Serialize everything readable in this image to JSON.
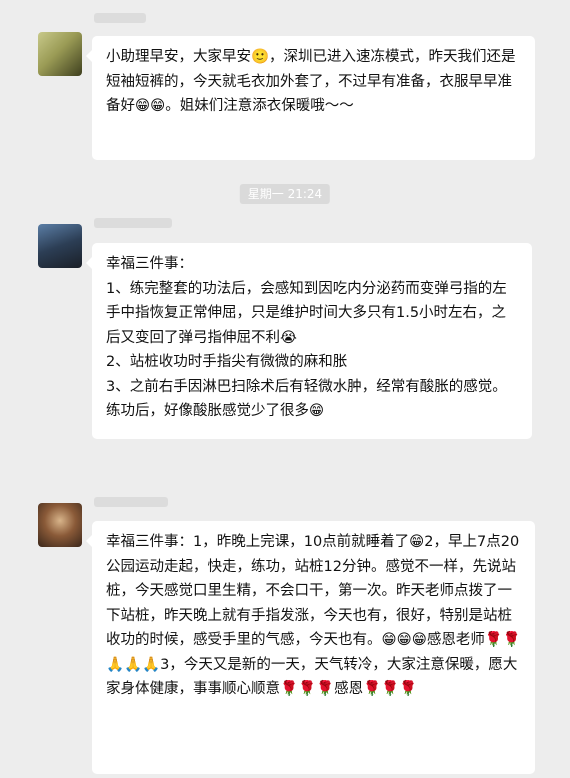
{
  "chat": {
    "timestamp": "星期一 21:24",
    "messages": [
      {
        "text": "小助理早安，大家早安🙂，深圳已进入速冻模式，昨天我们还是短袖短裤的，今天就毛衣加外套了，不过早有准备，衣服早早准备好😁😁。姐妹们注意添衣保暖哦～～"
      },
      {
        "text": "幸福三件事：\n1、练完整套的功法后，会感知到因吃内分泌药而变弹弓指的左手中指恢复正常伸屈，只是维护时间大多只有1.5小时左右，之后又变回了弹弓指伸屈不利😭\n2、站桩收功时手指尖有微微的麻和胀\n3、之前右手因淋巴扫除术后有轻微水肿，经常有酸胀的感觉。练功后，好像酸胀感觉少了很多😁"
      },
      {
        "text": "幸福三件事：1，昨晚上完课，10点前就睡着了😁2，早上7点20公园运动走起，快走，练功，站桩12分钟。感觉不一样，先说站桩，今天感觉口里生精，不会口干，第一次。昨天老师点拨了一下站桩，昨天晚上就有手指发涨，今天也有，很好，特别是站桩收功的时候，感受手里的气感，今天也有。😁😁😁感恩老师🌹🌹🙏🙏🙏3，今天又是新的一天，天气转冷，大家注意保暖，愿大家身体健康，事事顺心顺意🌹🌹🌹感恩🌹🌹🌹"
      }
    ]
  }
}
